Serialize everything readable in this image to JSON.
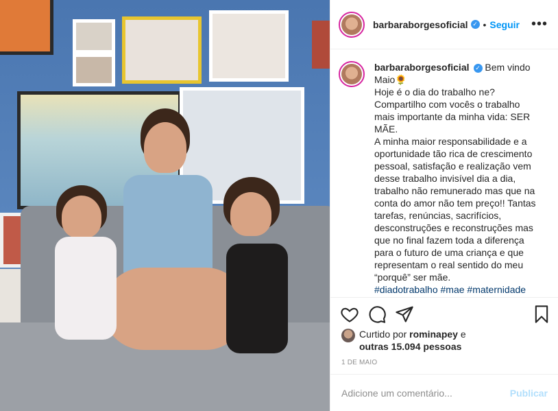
{
  "post": {
    "username": "barbaraborgesoficial",
    "verified_glyph": "✓",
    "separator": "•",
    "follow_label": "Seguir",
    "more_glyph": "•••",
    "caption": "Bem vindo\nMaio🌻\nHoje é o dia do trabalho ne?\nCompartilho com vocês o trabalho\nmais importante da minha vida: SER\nMÃE.\nA minha maior responsabilidade e a\noportunidade tão rica de crescimento\npessoal, satisfação e realização vem\ndesse trabalho invisível dia a dia,\ntrabalho não remunerado mas que na\nconta do amor não tem preço!! Tantas\ntarefas, renúncias, sacrifícios,\ndesconstruções e reconstruções mas\nque no final fazem toda a diferença\npara o futuro de uma criança e que\nrepresentam o real sentido do meu\n“porquê” ser mãe.",
    "hashtags": "#diadotrabalho #mae #maternidade"
  },
  "likes": {
    "prefix": "Curtido por",
    "user": "rominapey",
    "joiner": "e",
    "others": "outras 15.094 pessoas"
  },
  "date": "1 DE MAIO",
  "comment": {
    "placeholder": "Adicione um comentário...",
    "publish_label": "Publicar"
  },
  "icons": {
    "like": "heart-icon",
    "comment": "comment-icon",
    "share": "share-icon",
    "save": "bookmark-icon",
    "more": "more-options-icon"
  },
  "colors": {
    "accent": "#0095f6",
    "publish_disabled": "#b2dffc",
    "story_ring": "#d6249f"
  }
}
